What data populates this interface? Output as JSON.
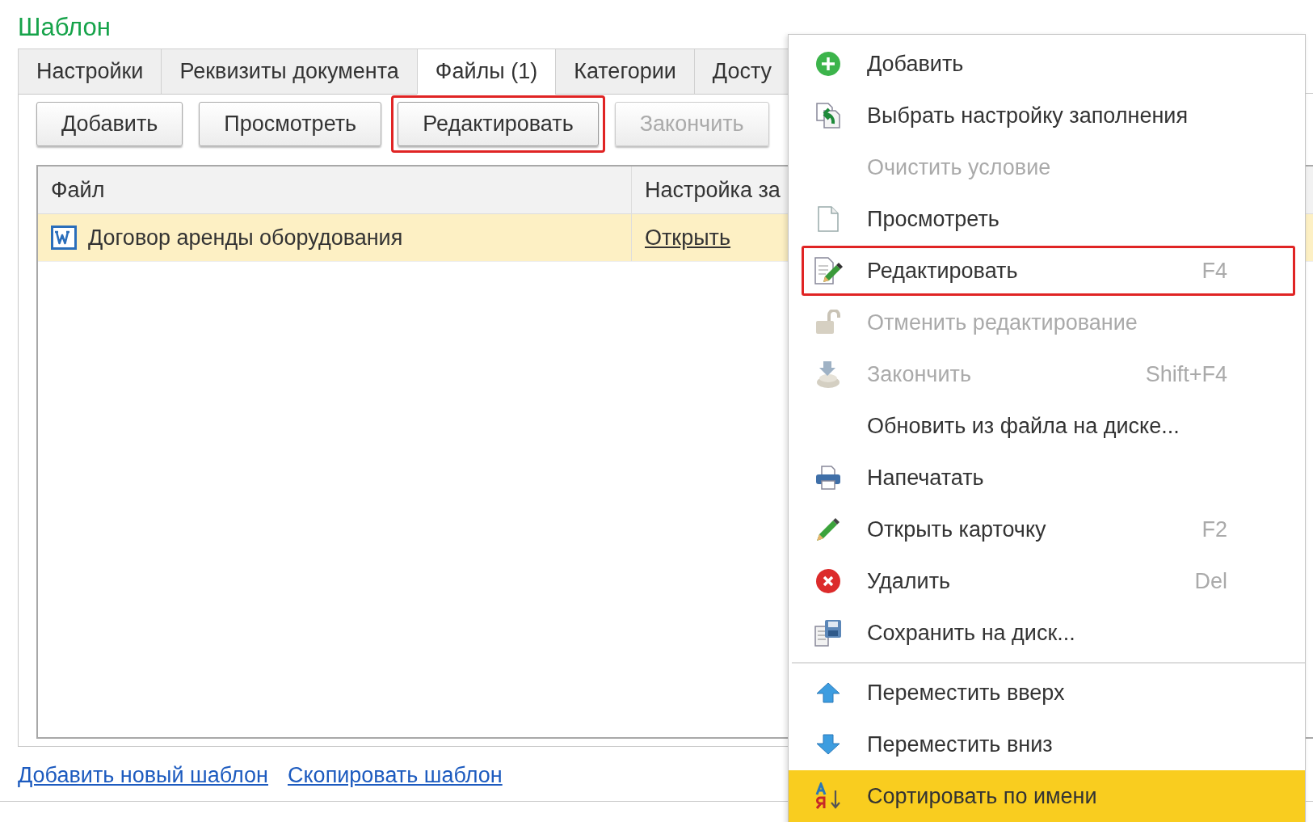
{
  "title": "Шаблон",
  "tabs": [
    {
      "label": "Настройки",
      "selected": false
    },
    {
      "label": "Реквизиты документа",
      "selected": false
    },
    {
      "label": "Файлы (1)",
      "selected": true
    },
    {
      "label": "Категории",
      "selected": false
    },
    {
      "label": "Досту",
      "selected": false
    }
  ],
  "toolbar": [
    {
      "label": "Добавить",
      "disabled": false,
      "outlined": false
    },
    {
      "label": "Просмотреть",
      "disabled": false,
      "outlined": false
    },
    {
      "label": "Редактировать",
      "disabled": false,
      "outlined": true
    },
    {
      "label": "Закончить",
      "disabled": true,
      "outlined": false
    }
  ],
  "table": {
    "columns": [
      "Файл",
      "Настройка за"
    ],
    "rows": [
      {
        "file": "Договор аренды оборудования",
        "setting": "Открыть",
        "selected": true
      }
    ]
  },
  "links": [
    "Добавить новый шаблон",
    "Скопировать шаблон"
  ],
  "context_menu": [
    {
      "label": "Добавить",
      "disabled": false,
      "selected": false,
      "outlined": false
    },
    {
      "label": "Выбрать настройку заполнения",
      "disabled": false,
      "selected": false,
      "outlined": false
    },
    {
      "label": "Очистить условие",
      "disabled": true,
      "selected": false,
      "outlined": false
    },
    {
      "label": "Просмотреть",
      "disabled": false,
      "selected": false,
      "outlined": false
    },
    {
      "label": "Редактировать",
      "shortcut": "F4",
      "disabled": false,
      "selected": false,
      "outlined": true
    },
    {
      "label": "Отменить редактирование",
      "disabled": true,
      "selected": false,
      "outlined": false
    },
    {
      "label": "Закончить",
      "shortcut": "Shift+F4",
      "disabled": true,
      "selected": false,
      "outlined": false
    },
    {
      "label": "Обновить из файла на диске...",
      "disabled": false,
      "selected": false,
      "outlined": false
    },
    {
      "label": "Напечатать",
      "disabled": false,
      "selected": false,
      "outlined": false
    },
    {
      "label": "Открыть карточку",
      "shortcut": "F2",
      "disabled": false,
      "selected": false,
      "outlined": false
    },
    {
      "label": "Удалить",
      "shortcut": "Del",
      "disabled": false,
      "selected": false,
      "outlined": false
    },
    {
      "label": "Сохранить на диск...",
      "disabled": false,
      "selected": false,
      "outlined": false
    },
    {
      "label": "Переместить вверх",
      "separator_before": true,
      "disabled": false,
      "selected": false,
      "outlined": false
    },
    {
      "label": "Переместить вниз",
      "disabled": false,
      "selected": false,
      "outlined": false
    },
    {
      "label": "Сортировать по имени",
      "disabled": false,
      "selected": true,
      "outlined": false
    }
  ]
}
